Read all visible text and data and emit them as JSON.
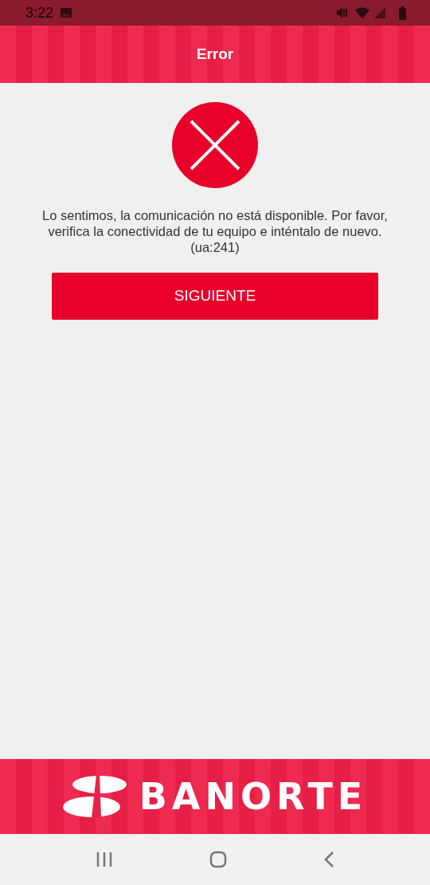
{
  "status_bar": {
    "time": "3:22"
  },
  "header": {
    "title": "Error"
  },
  "message": "Lo sentimos, la comunicación no está disponible.  Por favor, verifica la conectividad de tu equipo e inténtalo de nuevo. (ua:241)",
  "button": {
    "label": "SIGUIENTE"
  },
  "footer": {
    "brand": "BANORTE"
  }
}
